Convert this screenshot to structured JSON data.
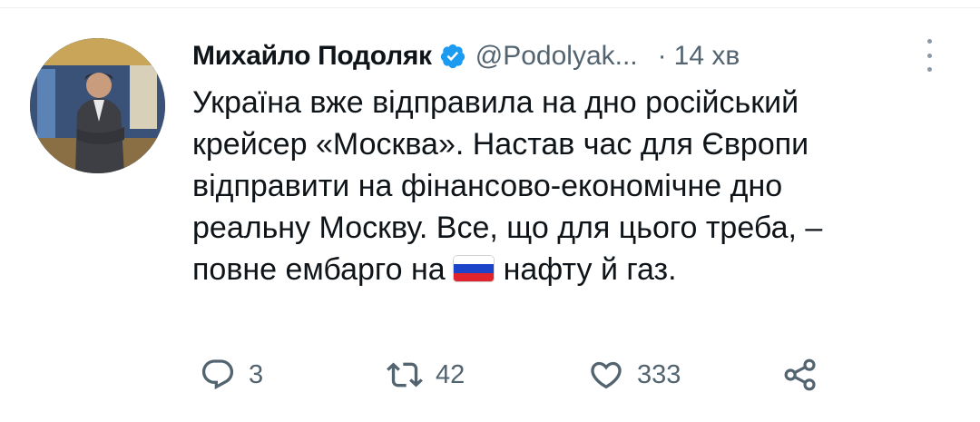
{
  "tweet": {
    "author_name": "Михайло Подоляк",
    "handle": "@Podolyak...",
    "separator": "·",
    "time": "14 хв",
    "lines": [
      "Україна вже відправила на дно російський",
      "крейсер «Москва». Настав час для Європи",
      "відправити на фінансово-економічне дно",
      "реальну Москву. Все, що для цього треба, –"
    ],
    "last_line_before_flag": "повне ембарго на",
    "last_line_after_flag": "нафту й газ.",
    "flag_icon": "russian-flag-emoji"
  },
  "actions": {
    "reply": {
      "icon": "reply-icon",
      "count": "3"
    },
    "retweet": {
      "icon": "retweet-icon",
      "count": "42"
    },
    "like": {
      "icon": "heart-icon",
      "count": "333"
    },
    "share": {
      "icon": "share-icon"
    }
  },
  "colors": {
    "text": "#0f1419",
    "secondary": "#536471",
    "verified": "#1d9bf0"
  }
}
